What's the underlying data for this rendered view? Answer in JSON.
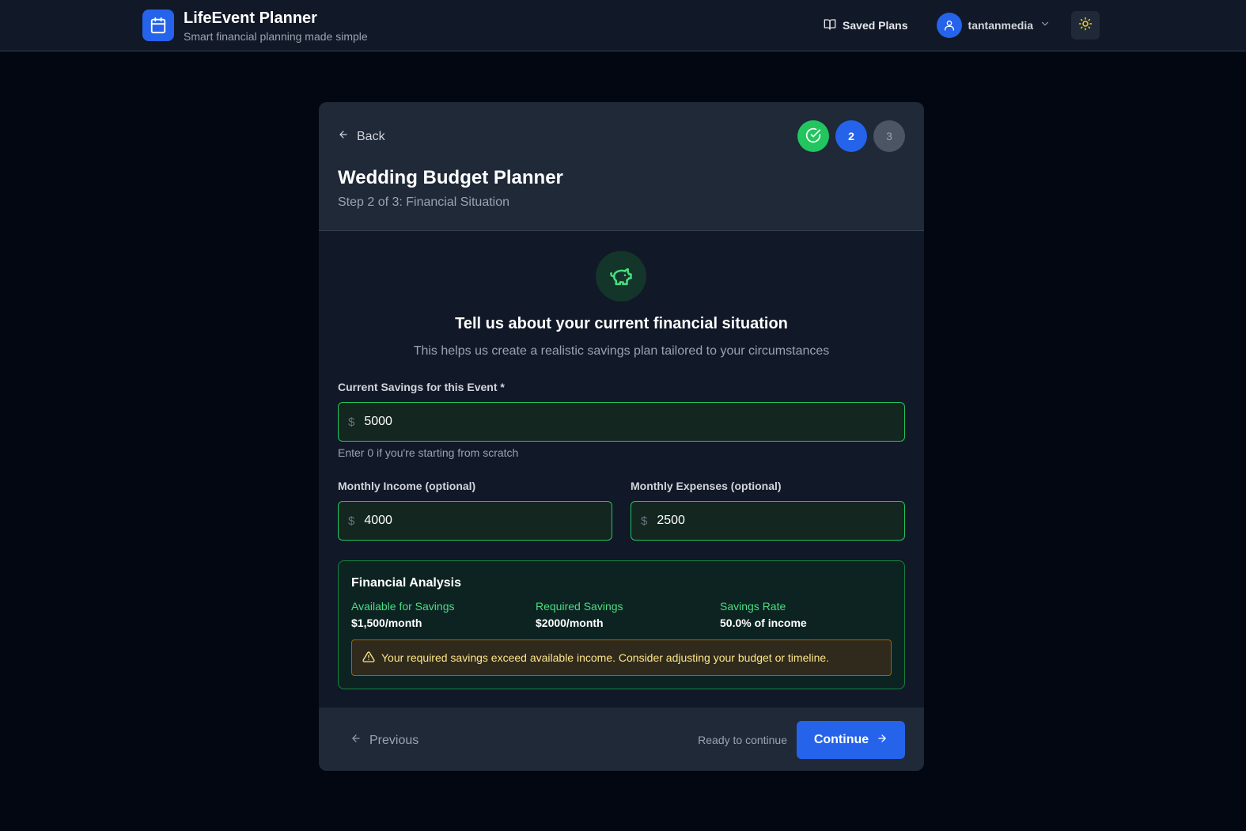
{
  "header": {
    "app_title": "LifeEvent Planner",
    "app_subtitle": "Smart financial planning made simple",
    "saved_plans_label": "Saved Plans",
    "username": "tantanmedia",
    "icons": {
      "logo": "calendar-icon",
      "saved": "book-open-icon",
      "user": "user-icon",
      "menu": "chevron-down-icon",
      "theme": "sun-icon"
    }
  },
  "card": {
    "back_label": "Back",
    "steps": [
      {
        "label": "",
        "state": "completed"
      },
      {
        "label": "2",
        "state": "active"
      },
      {
        "label": "3",
        "state": "upcoming"
      }
    ],
    "title": "Wedding Budget Planner",
    "subtitle": "Step 2 of 3: Financial Situation"
  },
  "section": {
    "icon": "piggy-bank-icon",
    "title": "Tell us about your current financial situation",
    "subtitle": "This helps us create a realistic savings plan tailored to your circumstances"
  },
  "form": {
    "currency_symbol": "$",
    "current_savings": {
      "label": "Current Savings for this Event *",
      "value": "5000",
      "hint": "Enter 0 if you're starting from scratch"
    },
    "monthly_income": {
      "label": "Monthly Income (optional)",
      "value": "4000"
    },
    "monthly_expenses": {
      "label": "Monthly Expenses (optional)",
      "value": "2500"
    }
  },
  "analysis": {
    "title": "Financial Analysis",
    "metrics": [
      {
        "label": "Available for Savings",
        "value": "$1,500/month"
      },
      {
        "label": "Required Savings",
        "value": "$2000/month"
      },
      {
        "label": "Savings Rate",
        "value": "50.0% of income"
      }
    ],
    "warning": "Your required savings exceed available income. Consider adjusting your budget or timeline."
  },
  "footer": {
    "previous_label": "Previous",
    "status": "Ready to continue",
    "continue_label": "Continue"
  },
  "colors": {
    "accent": "#2563eb",
    "success": "#22c55e",
    "warning": "#a16207",
    "background": "#030712"
  }
}
